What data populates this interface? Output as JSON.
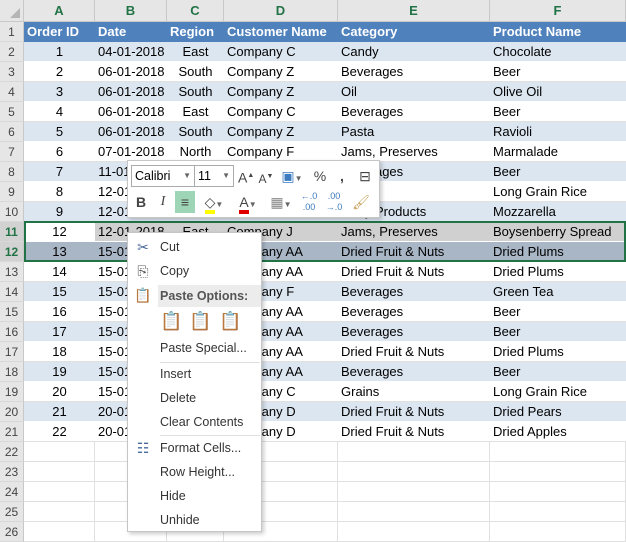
{
  "columns": [
    "A",
    "B",
    "C",
    "D",
    "E",
    "F"
  ],
  "row_numbers": [
    "1",
    "2",
    "3",
    "4",
    "5",
    "6",
    "7",
    "8",
    "9",
    "10",
    "11",
    "12",
    "13",
    "14",
    "15",
    "16",
    "17",
    "18",
    "19",
    "20",
    "21",
    "22",
    "23",
    "24",
    "25",
    "26"
  ],
  "headers": [
    "Order ID",
    "Date",
    "Region",
    "Customer Name",
    "Category",
    "Product Name"
  ],
  "rows": [
    [
      "1",
      "04-01-2018",
      "East",
      "Company C",
      "Candy",
      "Chocolate"
    ],
    [
      "2",
      "06-01-2018",
      "South",
      "Company Z",
      "Beverages",
      "Beer"
    ],
    [
      "3",
      "06-01-2018",
      "South",
      "Company Z",
      "Oil",
      "Olive Oil"
    ],
    [
      "4",
      "06-01-2018",
      "East",
      "Company C",
      "Beverages",
      "Beer"
    ],
    [
      "5",
      "06-01-2018",
      "South",
      "Company Z",
      "Pasta",
      "Ravioli"
    ],
    [
      "6",
      "07-01-2018",
      "North",
      "Company F",
      "Jams, Preserves",
      "Marmalade"
    ],
    [
      "7",
      "11-01-2018",
      "",
      "",
      "Beverages",
      "Beer"
    ],
    [
      "8",
      "12-01-2018",
      "",
      "",
      "",
      "Long Grain Rice"
    ],
    [
      "9",
      "12-01-2018",
      "",
      "",
      "Dairy Products",
      "Mozzarella"
    ],
    [
      "12",
      "12-01-2018",
      "East",
      "Company J",
      "Jams, Preserves",
      "Boysenberry Spread"
    ],
    [
      "13",
      "15-01-2018",
      "",
      "Company AA",
      "Dried Fruit & Nuts",
      "Dried Plums"
    ],
    [
      "14",
      "15-01-2018",
      "",
      "Company AA",
      "Dried Fruit & Nuts",
      "Dried Plums"
    ],
    [
      "15",
      "15-01-2018",
      "",
      "Company F",
      "Beverages",
      "Green Tea"
    ],
    [
      "16",
      "15-01-2018",
      "",
      "Company AA",
      "Beverages",
      "Beer"
    ],
    [
      "17",
      "15-01-2018",
      "",
      "Company AA",
      "Beverages",
      "Beer"
    ],
    [
      "18",
      "15-01-2018",
      "",
      "Company AA",
      "Dried Fruit & Nuts",
      "Dried Plums"
    ],
    [
      "19",
      "15-01-2018",
      "",
      "Company AA",
      "Beverages",
      "Beer"
    ],
    [
      "20",
      "15-01-2018",
      "",
      "Company C",
      "Grains",
      "Long Grain Rice"
    ],
    [
      "21",
      "20-01-2018",
      "",
      "Company D",
      "Dried Fruit & Nuts",
      "Dried Pears"
    ],
    [
      "22",
      "20-01-2018",
      "",
      "Company D",
      "Dried Fruit & Nuts",
      "Dried Apples"
    ]
  ],
  "mini_toolbar": {
    "font": "Calibri",
    "size": "11",
    "percent": "%",
    "comma": ","
  },
  "context_menu": {
    "cut": "Cut",
    "copy": "Copy",
    "paste_options": "Paste Options:",
    "paste_special": "Paste Special...",
    "insert": "Insert",
    "delete": "Delete",
    "clear_contents": "Clear Contents",
    "format_cells": "Format Cells...",
    "row_height": "Row Height...",
    "hide": "Hide",
    "unhide": "Unhide"
  },
  "colors": {
    "header_bg": "#4f81bd",
    "band": "#dce6f1",
    "selection": "#217346"
  }
}
